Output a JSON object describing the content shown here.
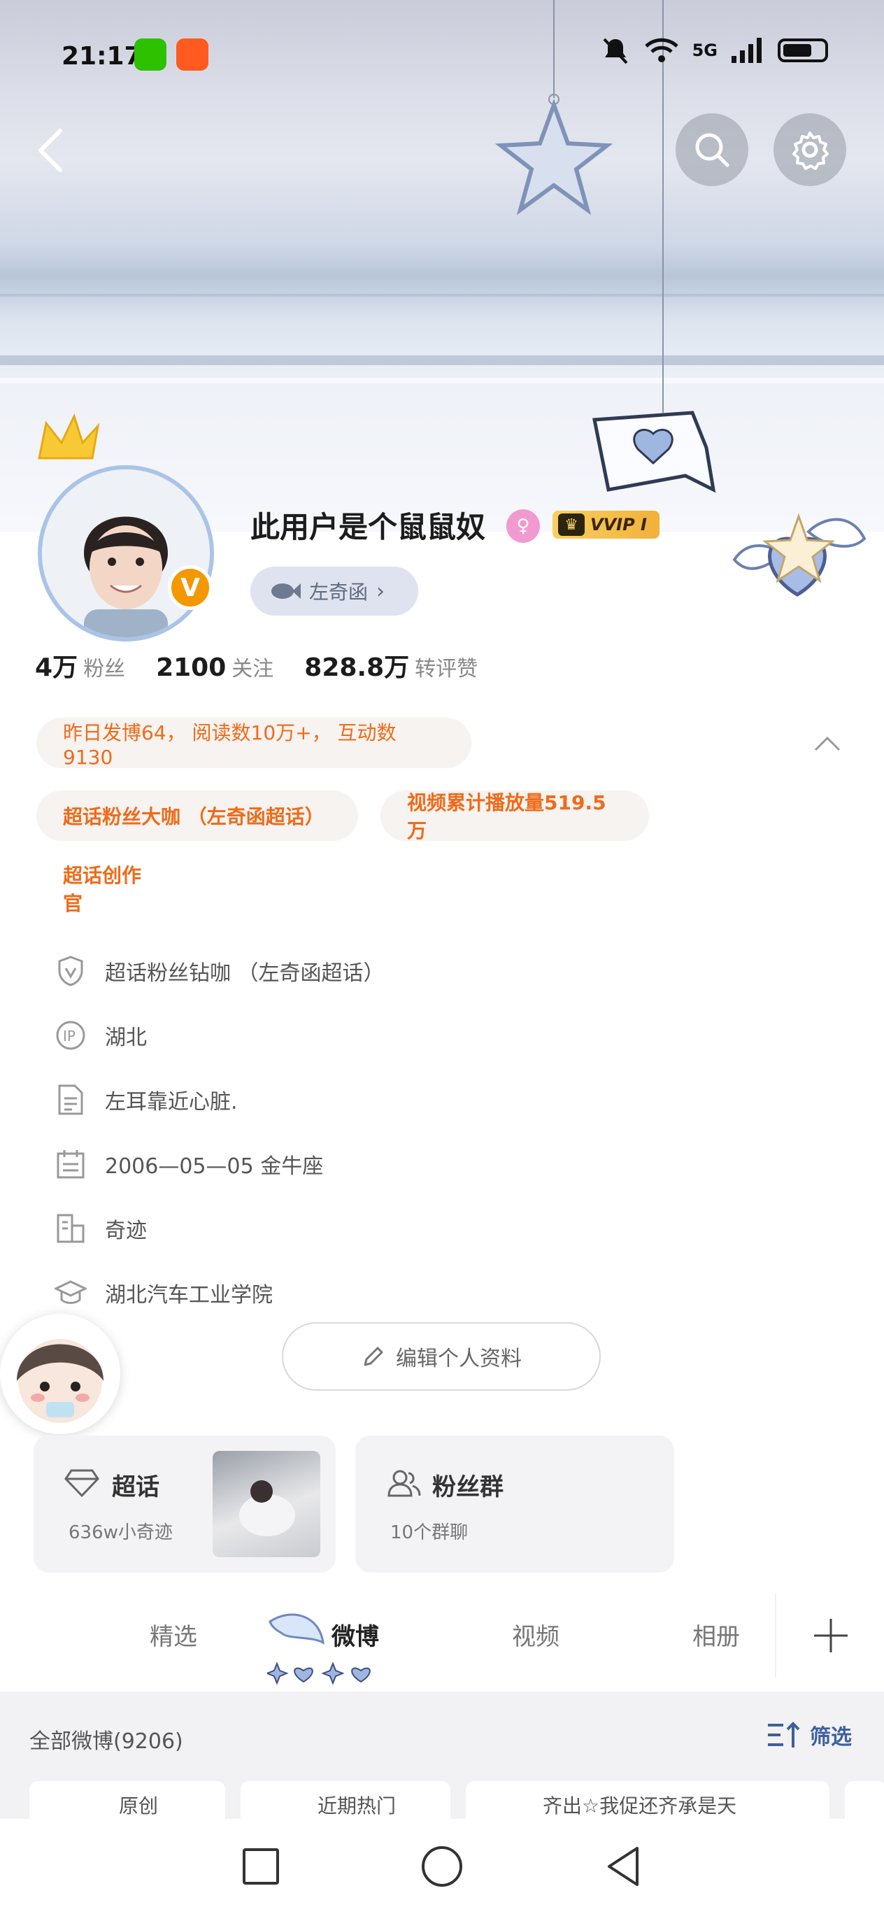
{
  "status_bar": {
    "time": "21:17",
    "network": "5G"
  },
  "profile": {
    "nickname": "此用户是个鼠鼠奴",
    "vip_badge": "VVIP I",
    "related_user": "左奇函",
    "stats": [
      {
        "num": "4万",
        "label": "粉丝"
      },
      {
        "num": "2100",
        "label": "关注"
      },
      {
        "num": "828.8万",
        "label": "转评赞"
      }
    ]
  },
  "highlights": {
    "yesterday": "昨日发博64， 阅读数10万+， 互动数9130",
    "tag1": "超话粉丝大咖 （左奇函超话）",
    "tag2": "视频累计播放量519.5万",
    "tag3": "超话创作官"
  },
  "info": [
    {
      "icon": "shield-v-icon",
      "text": "超话粉丝钻咖 （左奇函超话）"
    },
    {
      "icon": "ip-icon",
      "text": "湖北"
    },
    {
      "icon": "document-icon",
      "text": "左耳靠近心脏."
    },
    {
      "icon": "calendar-icon",
      "text": "2006—05—05  金牛座"
    },
    {
      "icon": "building-icon",
      "text": "奇迹"
    },
    {
      "icon": "graduation-cap-icon",
      "text": "湖北汽车工业学院"
    }
  ],
  "edit_profile": "编辑个人资料",
  "cards": {
    "super_topic": {
      "title": "超话",
      "sub": "636w小奇迹"
    },
    "fan_group": {
      "title": "粉丝群",
      "sub": "10个群聊"
    }
  },
  "tabs": [
    "精选",
    "微博",
    "视频",
    "相册"
  ],
  "active_tab": "微博",
  "feed": {
    "title": "全部微博(9206)",
    "filter": "筛选",
    "chips": [
      "原创",
      "近期热门",
      "齐出☆我促还齐承是天"
    ]
  },
  "colors": {
    "accent": "#ef6b1a",
    "link": "#3d5f9e"
  }
}
